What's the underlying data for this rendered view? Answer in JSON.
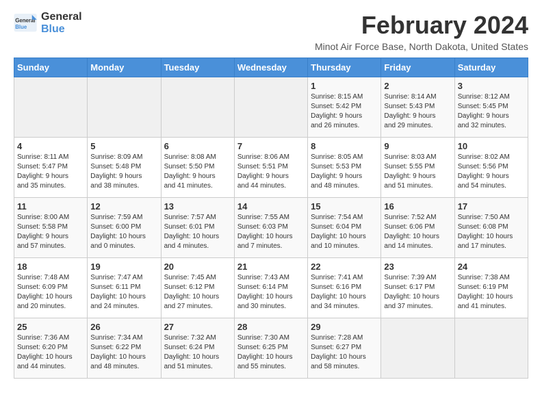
{
  "logo": {
    "line1": "General",
    "line2": "Blue"
  },
  "title": "February 2024",
  "subtitle": "Minot Air Force Base, North Dakota, United States",
  "days_of_week": [
    "Sunday",
    "Monday",
    "Tuesday",
    "Wednesday",
    "Thursday",
    "Friday",
    "Saturday"
  ],
  "weeks": [
    [
      {
        "day": "",
        "content": ""
      },
      {
        "day": "",
        "content": ""
      },
      {
        "day": "",
        "content": ""
      },
      {
        "day": "",
        "content": ""
      },
      {
        "day": "1",
        "content": "Sunrise: 8:15 AM\nSunset: 5:42 PM\nDaylight: 9 hours\nand 26 minutes."
      },
      {
        "day": "2",
        "content": "Sunrise: 8:14 AM\nSunset: 5:43 PM\nDaylight: 9 hours\nand 29 minutes."
      },
      {
        "day": "3",
        "content": "Sunrise: 8:12 AM\nSunset: 5:45 PM\nDaylight: 9 hours\nand 32 minutes."
      }
    ],
    [
      {
        "day": "4",
        "content": "Sunrise: 8:11 AM\nSunset: 5:47 PM\nDaylight: 9 hours\nand 35 minutes."
      },
      {
        "day": "5",
        "content": "Sunrise: 8:09 AM\nSunset: 5:48 PM\nDaylight: 9 hours\nand 38 minutes."
      },
      {
        "day": "6",
        "content": "Sunrise: 8:08 AM\nSunset: 5:50 PM\nDaylight: 9 hours\nand 41 minutes."
      },
      {
        "day": "7",
        "content": "Sunrise: 8:06 AM\nSunset: 5:51 PM\nDaylight: 9 hours\nand 44 minutes."
      },
      {
        "day": "8",
        "content": "Sunrise: 8:05 AM\nSunset: 5:53 PM\nDaylight: 9 hours\nand 48 minutes."
      },
      {
        "day": "9",
        "content": "Sunrise: 8:03 AM\nSunset: 5:55 PM\nDaylight: 9 hours\nand 51 minutes."
      },
      {
        "day": "10",
        "content": "Sunrise: 8:02 AM\nSunset: 5:56 PM\nDaylight: 9 hours\nand 54 minutes."
      }
    ],
    [
      {
        "day": "11",
        "content": "Sunrise: 8:00 AM\nSunset: 5:58 PM\nDaylight: 9 hours\nand 57 minutes."
      },
      {
        "day": "12",
        "content": "Sunrise: 7:59 AM\nSunset: 6:00 PM\nDaylight: 10 hours\nand 0 minutes."
      },
      {
        "day": "13",
        "content": "Sunrise: 7:57 AM\nSunset: 6:01 PM\nDaylight: 10 hours\nand 4 minutes."
      },
      {
        "day": "14",
        "content": "Sunrise: 7:55 AM\nSunset: 6:03 PM\nDaylight: 10 hours\nand 7 minutes."
      },
      {
        "day": "15",
        "content": "Sunrise: 7:54 AM\nSunset: 6:04 PM\nDaylight: 10 hours\nand 10 minutes."
      },
      {
        "day": "16",
        "content": "Sunrise: 7:52 AM\nSunset: 6:06 PM\nDaylight: 10 hours\nand 14 minutes."
      },
      {
        "day": "17",
        "content": "Sunrise: 7:50 AM\nSunset: 6:08 PM\nDaylight: 10 hours\nand 17 minutes."
      }
    ],
    [
      {
        "day": "18",
        "content": "Sunrise: 7:48 AM\nSunset: 6:09 PM\nDaylight: 10 hours\nand 20 minutes."
      },
      {
        "day": "19",
        "content": "Sunrise: 7:47 AM\nSunset: 6:11 PM\nDaylight: 10 hours\nand 24 minutes."
      },
      {
        "day": "20",
        "content": "Sunrise: 7:45 AM\nSunset: 6:12 PM\nDaylight: 10 hours\nand 27 minutes."
      },
      {
        "day": "21",
        "content": "Sunrise: 7:43 AM\nSunset: 6:14 PM\nDaylight: 10 hours\nand 30 minutes."
      },
      {
        "day": "22",
        "content": "Sunrise: 7:41 AM\nSunset: 6:16 PM\nDaylight: 10 hours\nand 34 minutes."
      },
      {
        "day": "23",
        "content": "Sunrise: 7:39 AM\nSunset: 6:17 PM\nDaylight: 10 hours\nand 37 minutes."
      },
      {
        "day": "24",
        "content": "Sunrise: 7:38 AM\nSunset: 6:19 PM\nDaylight: 10 hours\nand 41 minutes."
      }
    ],
    [
      {
        "day": "25",
        "content": "Sunrise: 7:36 AM\nSunset: 6:20 PM\nDaylight: 10 hours\nand 44 minutes."
      },
      {
        "day": "26",
        "content": "Sunrise: 7:34 AM\nSunset: 6:22 PM\nDaylight: 10 hours\nand 48 minutes."
      },
      {
        "day": "27",
        "content": "Sunrise: 7:32 AM\nSunset: 6:24 PM\nDaylight: 10 hours\nand 51 minutes."
      },
      {
        "day": "28",
        "content": "Sunrise: 7:30 AM\nSunset: 6:25 PM\nDaylight: 10 hours\nand 55 minutes."
      },
      {
        "day": "29",
        "content": "Sunrise: 7:28 AM\nSunset: 6:27 PM\nDaylight: 10 hours\nand 58 minutes."
      },
      {
        "day": "",
        "content": ""
      },
      {
        "day": "",
        "content": ""
      }
    ]
  ]
}
